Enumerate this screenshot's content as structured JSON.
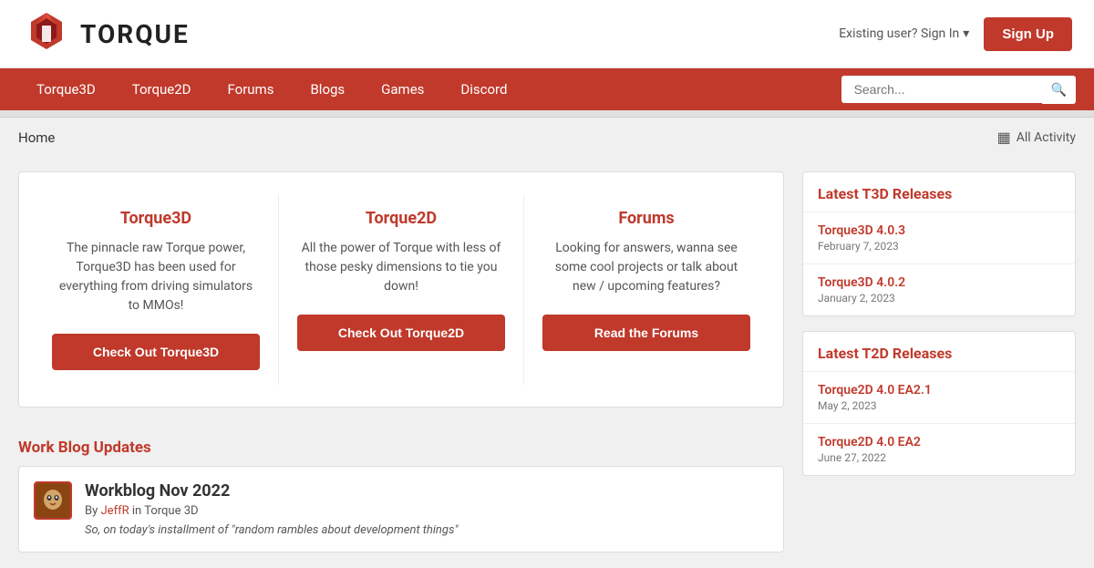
{
  "header": {
    "logo_text": "TORQUE",
    "sign_in_text": "Existing user? Sign In",
    "sign_up_label": "Sign Up"
  },
  "navbar": {
    "items": [
      {
        "label": "Torque3D"
      },
      {
        "label": "Torque2D"
      },
      {
        "label": "Forums"
      },
      {
        "label": "Blogs"
      },
      {
        "label": "Games"
      },
      {
        "label": "Discord"
      }
    ],
    "search_placeholder": "Search..."
  },
  "breadcrumb": {
    "home": "Home",
    "all_activity": "All Activity"
  },
  "cards": [
    {
      "title": "Torque3D",
      "desc": "The pinnacle raw Torque power, Torque3D has been used for everything from driving simulators to MMOs!",
      "btn_label": "Check Out Torque3D"
    },
    {
      "title": "Torque2D",
      "desc": "All the power of Torque with less of those pesky dimensions to tie you down!",
      "btn_label": "Check Out Torque2D"
    },
    {
      "title": "Forums",
      "desc": "Looking for answers, wanna see some cool projects or talk about new / upcoming features?",
      "btn_label": "Read the Forums"
    }
  ],
  "work_blog": {
    "section_title": "Work Blog Updates",
    "post": {
      "title": "Workblog Nov 2022",
      "author": "JeffR",
      "community": "Torque 3D",
      "meta_prefix": "By",
      "meta_in": "in",
      "excerpt": "So, on today's installment of \"random rambles about development things\""
    }
  },
  "sidebar": {
    "t3d_releases": {
      "title": "Latest T3D Releases",
      "items": [
        {
          "title": "Torque3D 4.0.3",
          "date": "February 7, 2023"
        },
        {
          "title": "Torque3D 4.0.2",
          "date": "January 2, 2023"
        }
      ]
    },
    "t2d_releases": {
      "title": "Latest T2D Releases",
      "items": [
        {
          "title": "Torque2D 4.0 EA2.1",
          "date": "May 2, 2023"
        },
        {
          "title": "Torque2D 4.0 EA2",
          "date": "June 27, 2022"
        }
      ]
    }
  }
}
